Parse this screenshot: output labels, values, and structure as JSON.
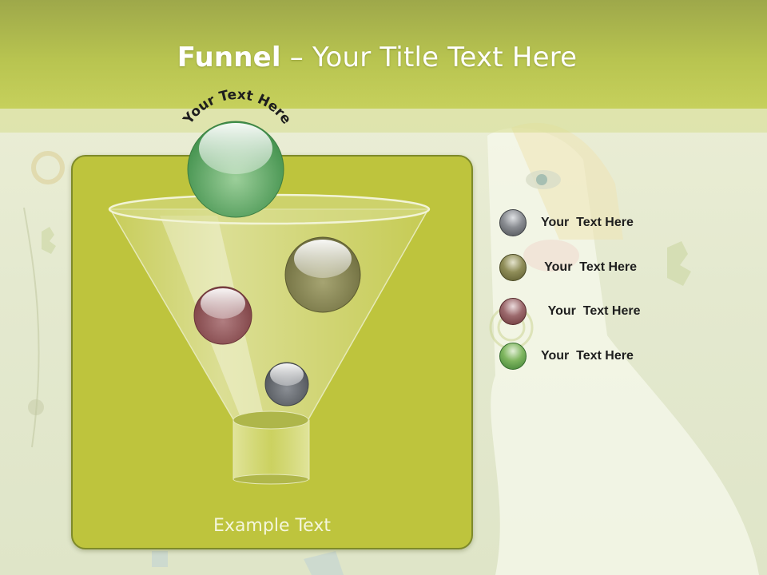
{
  "slide": {
    "title_bold": "Funnel",
    "title_rest": " – Your Title Text Here",
    "arc_text": "Your Text Here",
    "example_text": "Example Text"
  },
  "legend": [
    {
      "label": "Your  Text Here",
      "color": "#5c5f63"
    },
    {
      "label": " Your  Text Here",
      "color": "#6b6a3a"
    },
    {
      "label": "  Your  Text Here",
      "color": "#7a4a4e"
    },
    {
      "label": "Your  Text Here",
      "color": "#5a8a3a"
    }
  ],
  "colors": {
    "header": "#b8c450",
    "panel": "#bec43d",
    "ball_top": "#3f8f4a",
    "ball_right": "#6e6d3e",
    "ball_left": "#7c3f42",
    "ball_bottom": "#4f5358"
  }
}
